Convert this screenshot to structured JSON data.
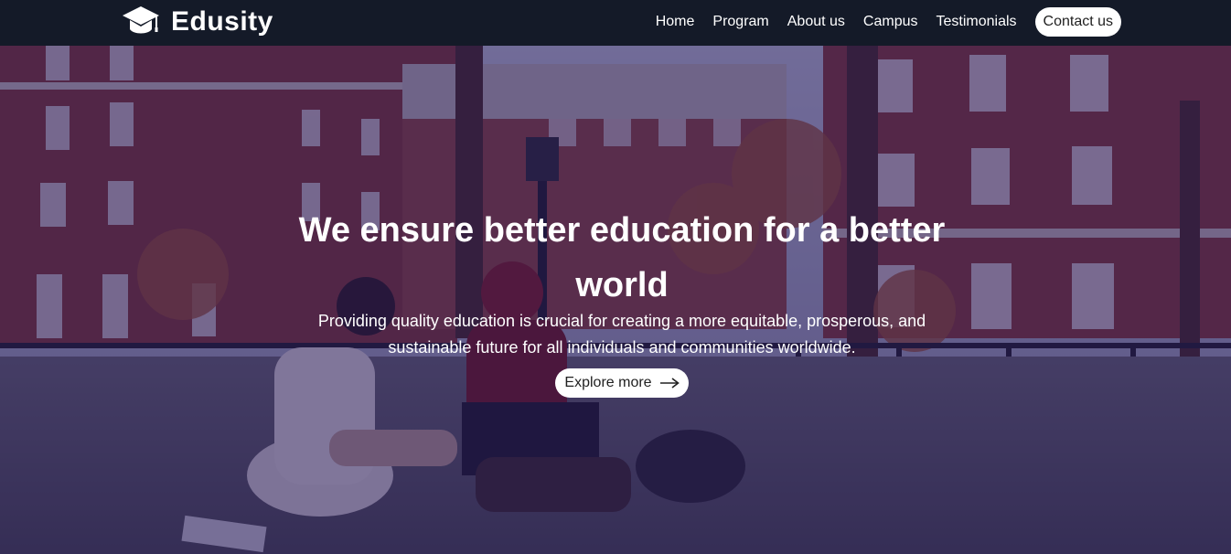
{
  "brand": {
    "name": "Edusity",
    "icon": "graduation-cap-icon"
  },
  "nav": {
    "links": [
      "Home",
      "Program",
      "About us",
      "Campus",
      "Testimonials"
    ],
    "contact_label": "Contact us"
  },
  "hero": {
    "title": "We ensure better education for a better world",
    "subtitle": "Providing quality education is crucial for creating a more equitable, prosperous, and sustainable future for all individuals and communities worldwide.",
    "button_label": "Explore more",
    "button_icon": "arrow-right-icon"
  },
  "colors": {
    "navbar_bg": "#141a28",
    "overlay": "#24165a",
    "button_bg": "#ffffff"
  }
}
